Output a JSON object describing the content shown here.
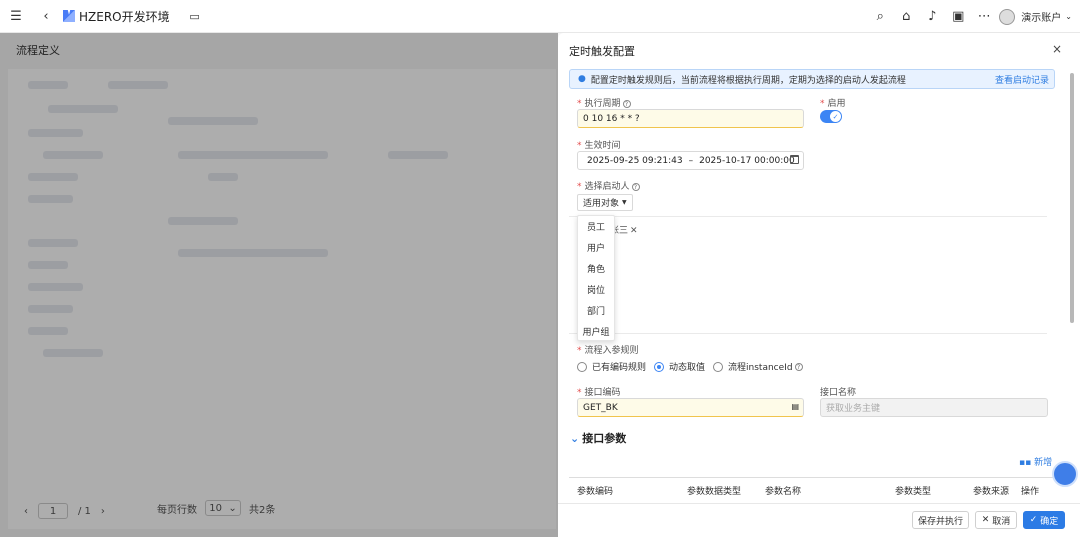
{
  "topbar": {
    "menu_icon": "hamburger-icon",
    "back_icon": "chevron-left-icon",
    "env_title": "HZERO开发环境",
    "monitor_icon": "monitor-icon",
    "icons": [
      "search-icon",
      "home-icon",
      "bell-icon",
      "shirt-icon",
      "more-icon"
    ],
    "user": "演示账户"
  },
  "bg": {
    "page_title": "流程定义",
    "pager": {
      "current": "1",
      "total": "/ 1",
      "prev": "‹",
      "next": "›"
    },
    "rows_per_page_label": "每页行数",
    "rows_per_page": "10",
    "total_text": "共2条"
  },
  "drawer": {
    "title": "定时触发配置",
    "close": "×",
    "info_text": "配置定时触发规则后，当前流程将根据执行周期，定期为选择的启动人发起流程",
    "info_link": "查看启动记录",
    "cycle_label": "执行周期",
    "cycle_value": "0 10 16 * * ?",
    "enable_label": "启用",
    "effective_label": "生效时间",
    "effective_start": "2025-09-25 09:21:43",
    "effective_sep": "–",
    "effective_end": "2025-10-17 00:00:00",
    "starter_label": "选择启动人",
    "scope_button": "适用对象",
    "selected_tag": "张三",
    "menu_items": [
      "员工",
      "用户",
      "角色",
      "岗位",
      "部门",
      "用户组"
    ],
    "param_rule_label": "流程入参规则",
    "radios": [
      {
        "label": "已有编码规则",
        "checked": false
      },
      {
        "label": "动态取值",
        "checked": true
      },
      {
        "label": "流程instanceId",
        "checked": false
      }
    ],
    "api_code_label": "接口编码",
    "api_code_value": "GET_BK",
    "api_name_label": "接口名称",
    "api_name_placeholder": "获取业务主键",
    "section_title": "接口参数",
    "add_label": "新增",
    "table_headers": [
      "参数编码",
      "参数数据类型",
      "参数名称",
      "参数类型",
      "参数来源",
      "操作"
    ],
    "footer": {
      "save_run": "保存并执行",
      "cancel": "取消",
      "ok": "确定"
    }
  }
}
